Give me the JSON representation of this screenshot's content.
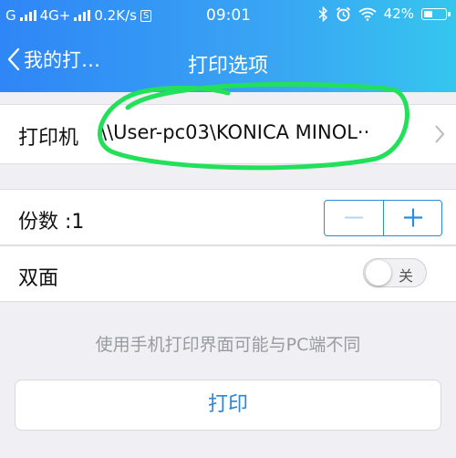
{
  "status_bar": {
    "carrier1": "G",
    "carrier2": "4G+",
    "speed": "0.2K/s",
    "s_badge": "S",
    "time": "09:01",
    "battery": "42%",
    "battery_level": 0.42,
    "icons": [
      "signal-icon",
      "bluetooth-icon",
      "alarm-icon",
      "wifi-icon",
      "battery-icon"
    ]
  },
  "nav": {
    "back_label": "我的打…",
    "title": "打印选项"
  },
  "printer": {
    "label": "打印机",
    "value": "\\\\User-pc03\\KONICA MINOL··"
  },
  "copies": {
    "label": "份数 :1"
  },
  "duplex": {
    "label": "双面",
    "toggle_label": "关",
    "on": false
  },
  "hint": "使用手机打印界面可能与PC端不同",
  "print_button": "打印",
  "colors": {
    "header_start": "#2f86f6",
    "header_end": "#35c6ee",
    "accent": "#2b86d6",
    "highlight_stroke": "#23e05a",
    "background": "#efeff4"
  }
}
